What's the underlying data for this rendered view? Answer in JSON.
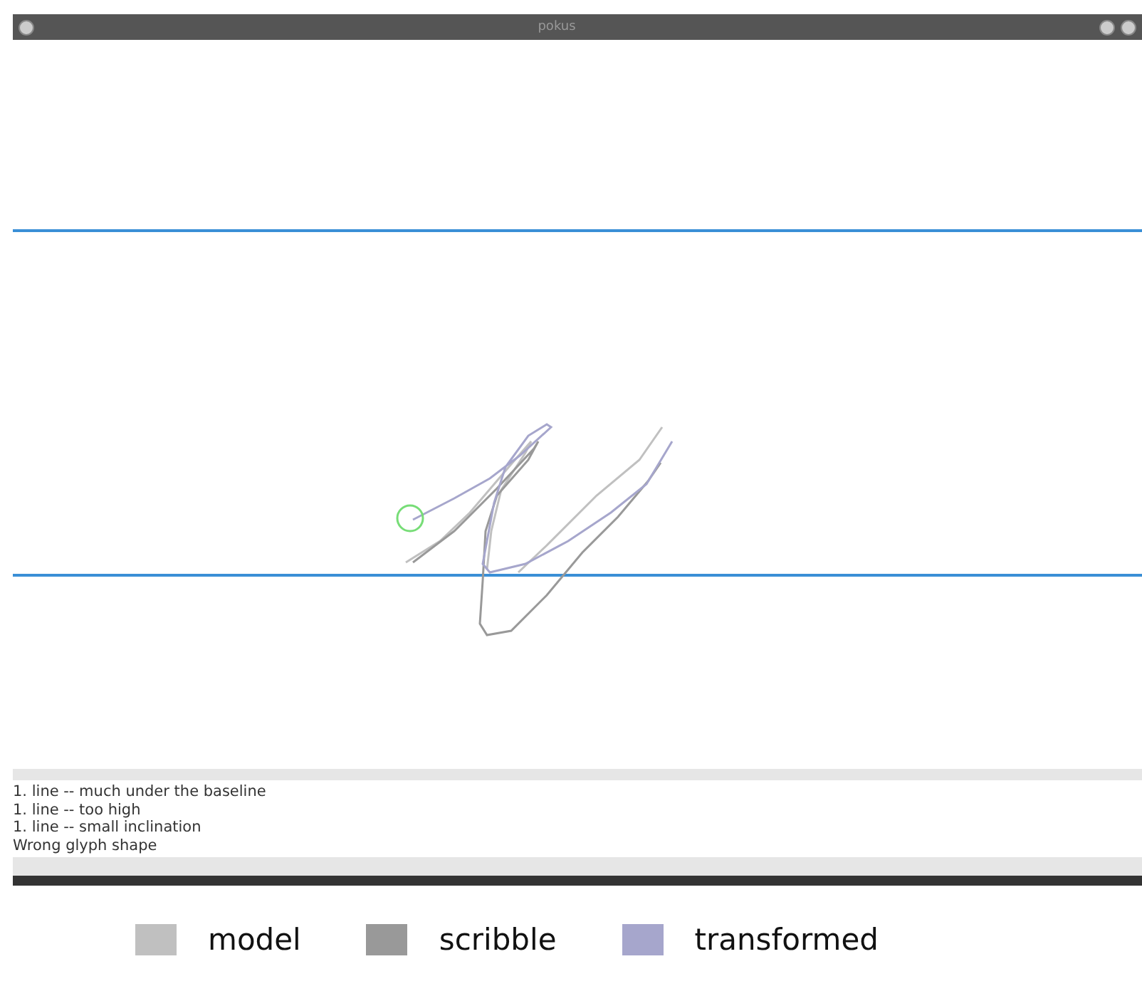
{
  "window": {
    "title": "pokus"
  },
  "messages": [
    "1. line -- much under the baseline",
    "1. line -- too high",
    "1. line -- small inclination",
    "Wrong glyph shape"
  ],
  "legend": [
    {
      "label": "model",
      "color": "#c0c0c0"
    },
    {
      "label": "scribble",
      "color": "#999999"
    },
    {
      "label": "transformed",
      "color": "#a6a6cc"
    }
  ]
}
